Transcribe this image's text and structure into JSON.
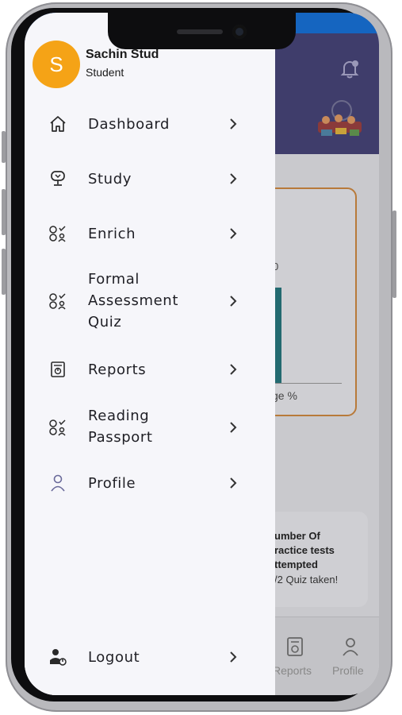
{
  "user": {
    "initial": "S",
    "name": "Sachin Stud",
    "role": "Student"
  },
  "menu": [
    {
      "label": "Dashboard",
      "icon": "home-icon"
    },
    {
      "label": "Study",
      "icon": "study-icon"
    },
    {
      "label": "Enrich",
      "icon": "enrich-icon"
    },
    {
      "label": "Formal\nAssessment\nQuiz",
      "icon": "quiz-icon"
    },
    {
      "label": "Reports",
      "icon": "reports-icon"
    },
    {
      "label": "Reading\nPassport",
      "icon": "reading-passport-icon"
    },
    {
      "label": "Profile",
      "icon": "profile-icon"
    }
  ],
  "logout": {
    "label": "Logout",
    "icon": "logout-icon"
  },
  "background": {
    "chart_fragment": "0",
    "chart_caption": "ge %",
    "card_title": "umber Of\nractice tests\nttempted",
    "card_sub": "/2 Quiz taken!",
    "nav_reports": "Reports",
    "nav_profile": "Profile"
  },
  "colors": {
    "avatar": "#f5a316",
    "header": "#3f3d6b",
    "drawer": "#f6f6fa"
  }
}
